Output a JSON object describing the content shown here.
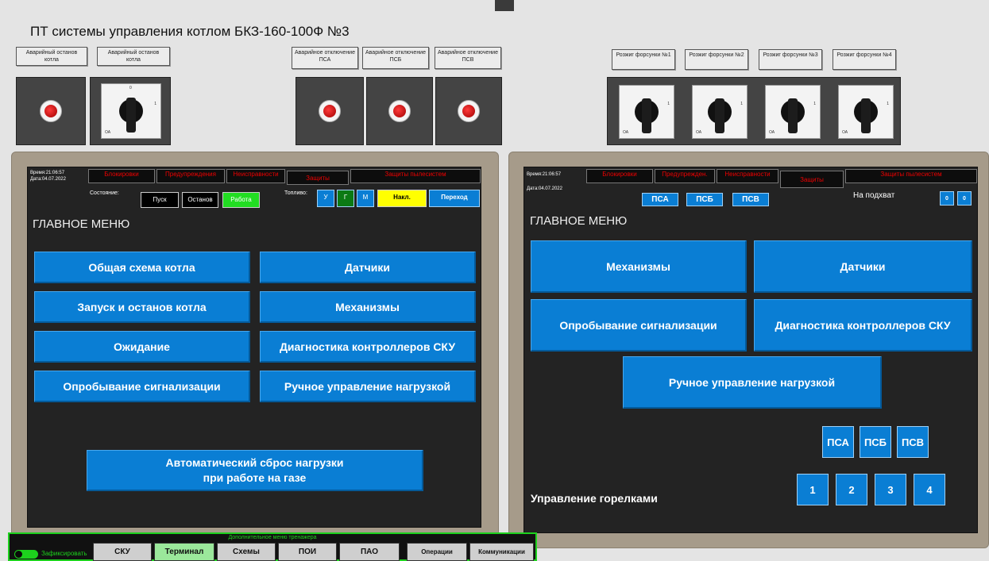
{
  "page": {
    "title": "ПТ системы управления котлом БКЗ-160-100Ф №3"
  },
  "panel_labels": {
    "stop1": "Аварийный останов котла",
    "stop2": "Аварийный останов котла",
    "psa": "Аварийное отключение ПСА",
    "psb": "Аварийное отключение ПСБ",
    "psv": "Аварийное отключение ПСВ",
    "r1": "Розжиг форсунки №1",
    "r2": "Розжиг форсунки №2",
    "r3": "Розжиг форсунки №3",
    "r4": "Розжиг форсунки №4"
  },
  "switch_marks": {
    "off": "ОА",
    "one": "1",
    "zero": "0"
  },
  "left": {
    "time": "Время:21:06:57",
    "date": "Дата:04.07.2022",
    "alarms": [
      "Блокировки",
      "Предупреждения",
      "Неисправности",
      "Защиты",
      "Защиты пылесистем"
    ],
    "state_label": "Состояние:",
    "state_buttons": [
      "Пуск",
      "Останов",
      "Работа"
    ],
    "fuel_label": "Топливо:",
    "fuel_buttons": [
      "У",
      "Г",
      "М"
    ],
    "nakl": "Накл.",
    "perehod": "Переход",
    "menu_title": "ГЛАВНОЕ МЕНЮ",
    "menu": [
      "Общая схема котла",
      "Датчики",
      "Запуск и останов котла",
      "Механизмы",
      "Ожидание",
      "Диагностика контроллеров СКУ",
      "Опробывание сигнализации",
      "Ручное управление нагрузкой"
    ],
    "auto_reset_1": "Автоматический сброс нагрузки",
    "auto_reset_2": "при работе на газе"
  },
  "right": {
    "time": "Время:21:06:57",
    "date": "Дата:04.07.2022",
    "alarms": [
      "Блокировки",
      "Предупрежден.",
      "Неисправности",
      "Защиты",
      "Защиты пылесистем"
    ],
    "ps_buttons": [
      "ПСА",
      "ПСБ",
      "ПСВ"
    ],
    "podhvat": "На подхват",
    "zero_a": "0",
    "zero_b": "0",
    "menu_title": "ГЛАВНОЕ МЕНЮ",
    "menu": [
      "Механизмы",
      "Датчики",
      "Опробывание сигнализации",
      "Диагностика контроллеров СКУ",
      "Ручное управление нагрузкой"
    ],
    "ps_small": [
      "ПСА",
      "ПСБ",
      "ПСВ"
    ],
    "burners_label": "Управление горелками",
    "burners": [
      "1",
      "2",
      "3",
      "4"
    ]
  },
  "bottom": {
    "extra_menu": "Дополнительное меню тренажера",
    "fix_label": "Зафиксировать",
    "tabs": [
      "СКУ",
      "Терминал",
      "Схемы",
      "ПОИ",
      "ПАО",
      "Операции",
      "Коммуникации"
    ]
  },
  "colors": {
    "accent": "#0a7ed4",
    "panel_bg": "#232323",
    "frame": "#a69b8a",
    "alarm": "#e00000",
    "work_green": "#22dd22",
    "nakl_yellow": "#ffff00",
    "active_tab": "#9be89b"
  }
}
